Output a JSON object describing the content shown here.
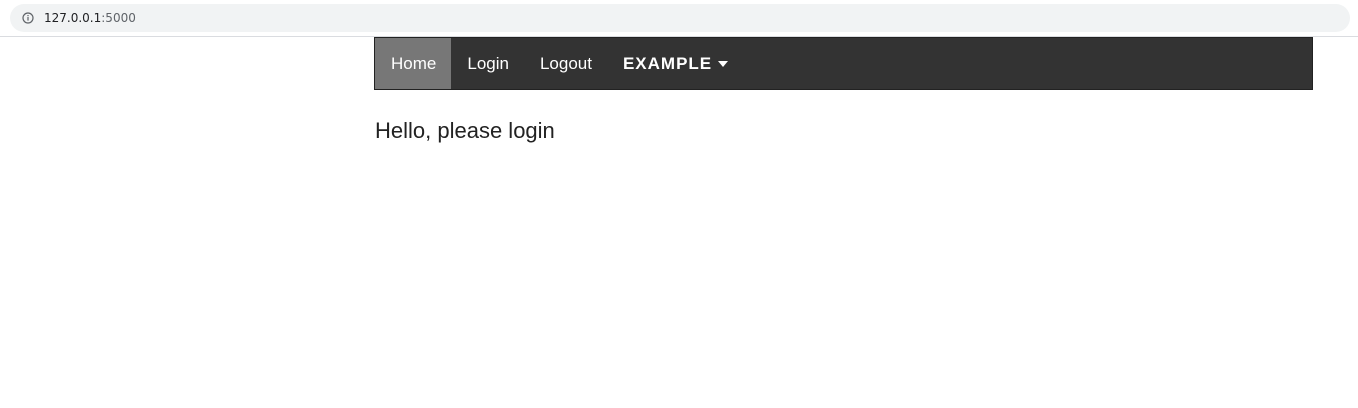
{
  "browser": {
    "url_host": "127.0.0.1",
    "url_port": ":5000"
  },
  "nav": {
    "items": [
      {
        "label": "Home",
        "active": true
      },
      {
        "label": "Login",
        "active": false
      },
      {
        "label": "Logout",
        "active": false
      }
    ],
    "dropdown_label": "EXAMPLE"
  },
  "main": {
    "greeting": "Hello, please login"
  },
  "colors": {
    "navbar_bg": "#333333",
    "active_item_bg": "#777777"
  }
}
